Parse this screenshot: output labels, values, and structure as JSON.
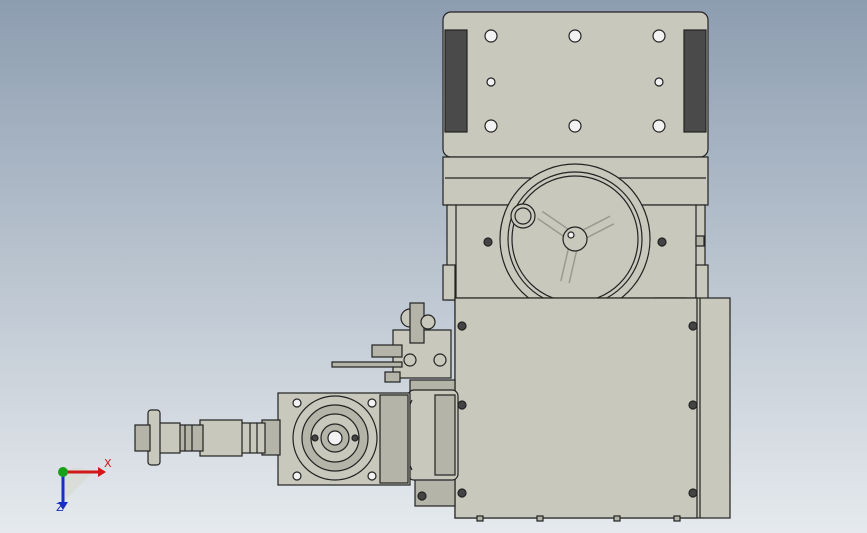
{
  "viewport": {
    "background_top": "#8d9db0",
    "background_bottom": "#e6eaee",
    "model_colors": {
      "body": "#c8c8bc",
      "body_dark": "#b4b4a8",
      "edge": "#222222",
      "rubber": "#4a4a4a"
    }
  },
  "triad": {
    "x_label": "X",
    "y_label": "Y",
    "z_label": "Z",
    "x_color": "#d01818",
    "y_color": "#18a018",
    "z_color": "#1830c0"
  }
}
